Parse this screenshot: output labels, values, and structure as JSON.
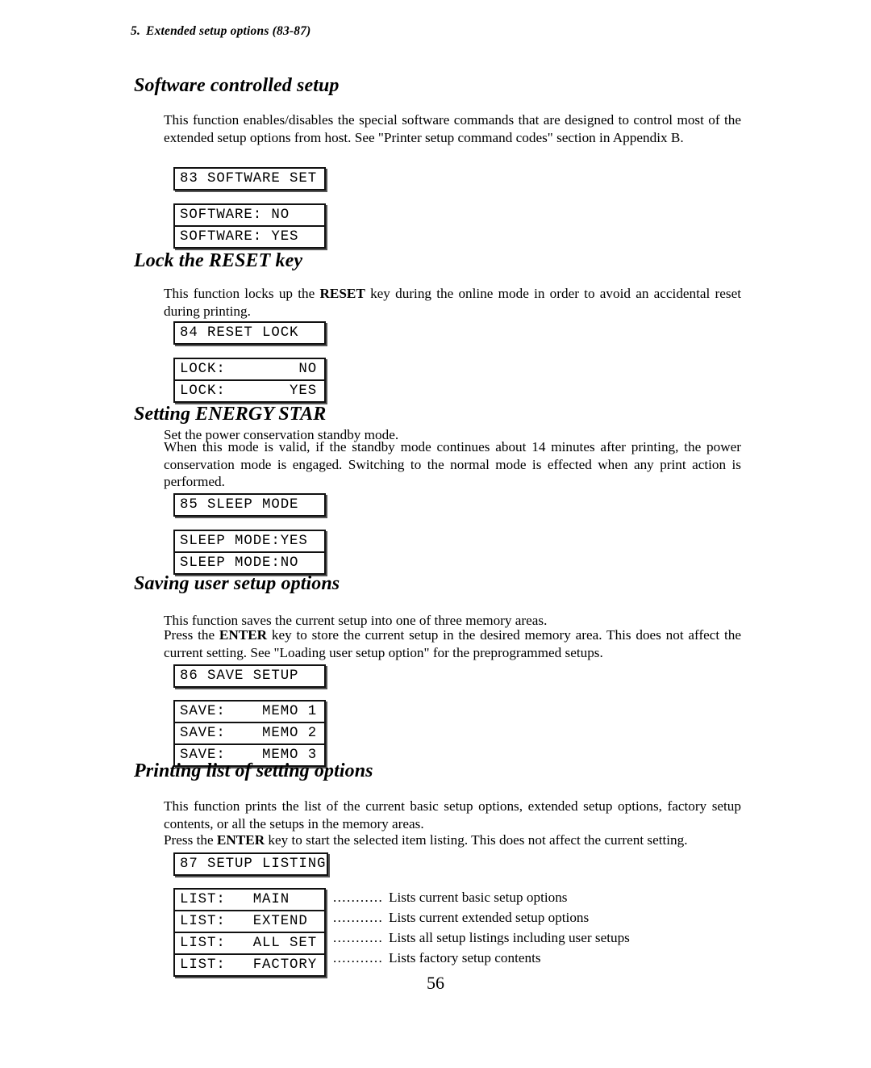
{
  "running_head": {
    "number": "5.",
    "text": "Extended setup options (83-87)"
  },
  "page_number": "56",
  "sections": [
    {
      "heading": "Software controlled setup",
      "paragraphs": [
        "This function enables/disables the special software commands that are designed to control most of the extended setup options from host.  See \"Printer setup command codes\" section in Appendix B."
      ],
      "code_box": "83 SOFTWARE SET",
      "option_rows": [
        "SOFTWARE: NO",
        "SOFTWARE: YES"
      ]
    },
    {
      "heading": "Lock the RESET key",
      "paragraphs": [
        "This function locks up the RESET key during the online mode in order to avoid an accidental reset during printing."
      ],
      "code_box": "84 RESET LOCK",
      "option_rows": [
        "LOCK:        NO",
        "LOCK:       YES"
      ]
    },
    {
      "heading": "Setting ENERGY STAR",
      "paragraphs": [
        "Set the power conservation standby mode.",
        "When this mode is valid, if the standby mode continues about 14 minutes after printing, the power conservation mode is engaged. Switching to the normal mode is effected when any print action is performed."
      ],
      "code_box": "85 SLEEP MODE",
      "option_rows": [
        "SLEEP MODE:YES",
        "SLEEP MODE:NO"
      ]
    },
    {
      "heading": "Saving user setup options",
      "paragraphs": [
        "This function saves the current setup into one of three memory areas.",
        "Press the ENTER key to store the current setup in the desired memory area.  This does not affect the current setting.  See \"Loading user setup option\" for the preprogrammed setups."
      ],
      "code_box": "86 SAVE SETUP",
      "option_rows": [
        "SAVE:    MEMO 1",
        "SAVE:    MEMO 2",
        "SAVE:    MEMO 3"
      ]
    },
    {
      "heading": "Printing list of setting options",
      "paragraphs": [
        "This function prints the list of the current basic setup options, extended setup options, factory setup contents, or all the setups in the memory areas.",
        "Press the ENTER key to start the selected item listing.  This does not affect the current setting."
      ],
      "code_box": "87 SETUP LISTING",
      "option_rows": [
        "LIST:   MAIN",
        "LIST:   EXTEND",
        "LIST:   ALL SET",
        "LIST:   FACTORY"
      ],
      "notes": [
        {
          "dots": "...........",
          "text": "Lists current basic setup options"
        },
        {
          "dots": "...........",
          "text": "Lists current extended setup options"
        },
        {
          "dots": "...........",
          "text": "Lists all setup listings including user setups"
        },
        {
          "dots": "...........",
          "text": "Lists factory setup contents"
        }
      ]
    }
  ],
  "inline_bold": {
    "reset": "RESET",
    "enter": "ENTER"
  }
}
